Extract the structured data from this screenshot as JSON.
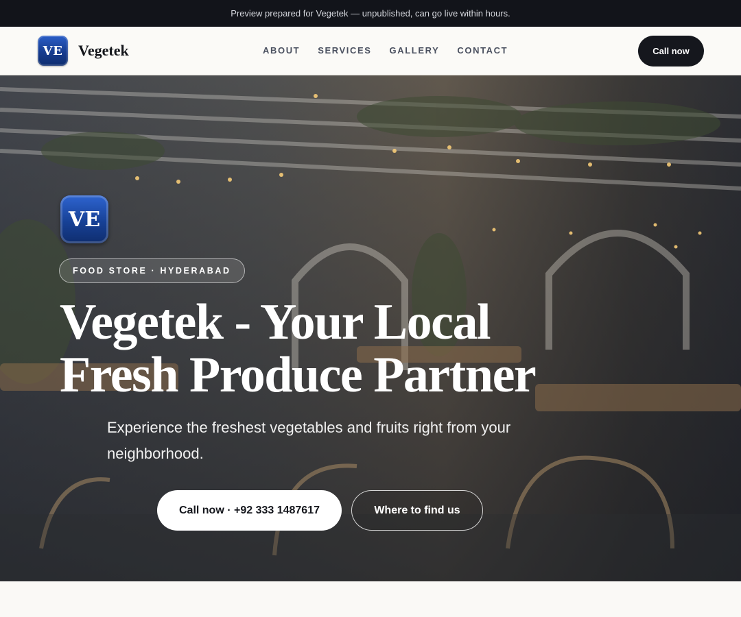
{
  "announcement": "Preview prepared for Vegetek — unpublished, can go live within hours.",
  "header": {
    "logo_text": "VE",
    "brand_name": "Vegetek",
    "menu": [
      "ABOUT",
      "SERVICES",
      "GALLERY",
      "CONTACT"
    ],
    "cta_label": "Call now"
  },
  "hero": {
    "logo_text": "VE",
    "eyebrow": "FOOD STORE · HYDERABAD",
    "headline": "Vegetek - Your Local Fresh Produce Partner",
    "subtext": "Experience the freshest vegetables and fruits right from your neighborhood.",
    "primary_button": "Call now · +92 333 1487617",
    "secondary_button": "Where to find us"
  },
  "colors": {
    "dark": "#15171d",
    "logo_blue": "#174196",
    "page_background": "#faf9f6"
  }
}
